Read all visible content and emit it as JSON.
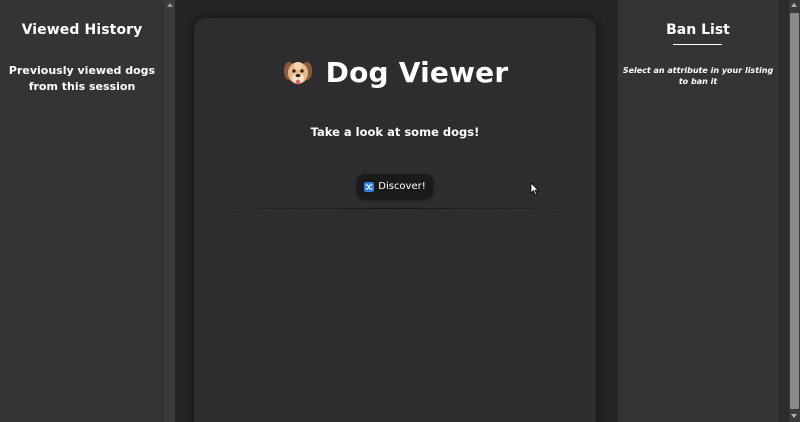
{
  "left_sidebar": {
    "title": "Viewed History",
    "subtitle": "Previously viewed dogs from this session"
  },
  "main": {
    "title": "Dog Viewer",
    "title_icon": "dog-face-icon",
    "tagline": "Take a look at some dogs!",
    "discover_button": {
      "label": "Discover!",
      "icon": "shuffle-icon"
    }
  },
  "right_sidebar": {
    "title": "Ban List",
    "hint": "Select an attribute in your listing to ban it"
  },
  "colors": {
    "page_background": "#252526",
    "sidebar_background": "#343436",
    "card_background": "#2d2d2f",
    "button_background": "#1a1a1a",
    "shuffle_icon_blue": "#2f7fd8",
    "text": "#ffffff"
  }
}
